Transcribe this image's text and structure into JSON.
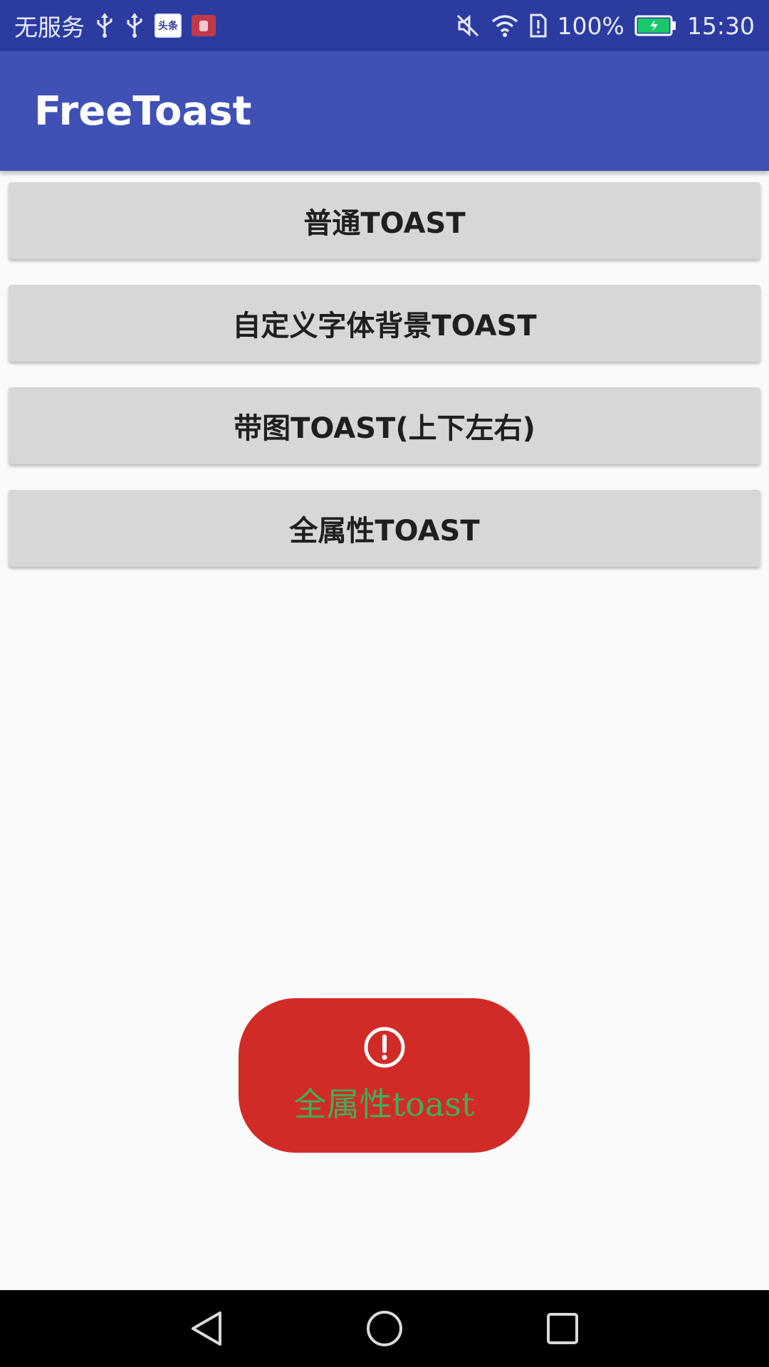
{
  "status_bar": {
    "carrier": "无服务",
    "icons_left": [
      "usb-icon",
      "usb-icon",
      "toutiao-notification-icon",
      "app-notification-icon"
    ],
    "badge_toutiao": "头条",
    "icons_right": [
      "mute-icon",
      "wifi-icon",
      "sim-alert-icon",
      "battery-icon"
    ],
    "battery": "100%",
    "time": "15:30"
  },
  "app_bar": {
    "title": "FreeToast"
  },
  "buttons": [
    {
      "label": "普通TOAST"
    },
    {
      "label": "自定义字体背景TOAST"
    },
    {
      "label": "带图TOAST(上下左右)"
    },
    {
      "label": "全属性TOAST"
    }
  ],
  "toast": {
    "icon": "alert-circle-icon",
    "text": "全属性toast",
    "background_color": "#d12b27",
    "text_color": "#3fae5a"
  },
  "nav_bar": {
    "items": [
      "back-icon",
      "home-icon",
      "recents-icon"
    ]
  },
  "colors": {
    "status_bar": "#2c3b9f",
    "app_bar": "#3f51b5",
    "button_bg": "#d6d7d7",
    "page_bg": "#fafafa"
  }
}
